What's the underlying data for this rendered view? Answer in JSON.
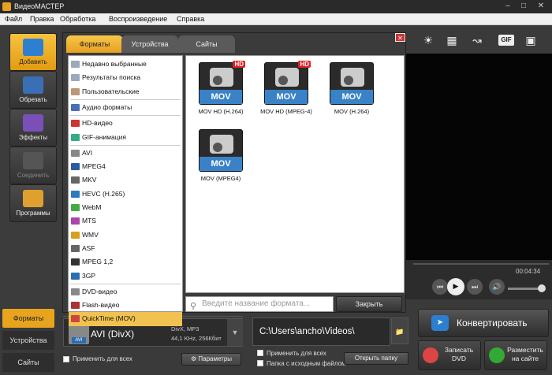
{
  "app": {
    "title": "ВидеоМАСТЕР"
  },
  "menu": [
    "Файл",
    "Правка",
    "Обработка",
    "Воспроизведение",
    "Справка"
  ],
  "sidebar": [
    {
      "label": "Добавить",
      "icon": "add-file-icon",
      "active": true
    },
    {
      "label": "Обрезать",
      "icon": "film-cut-icon"
    },
    {
      "label": "Эффекты",
      "icon": "effects-wand-icon"
    },
    {
      "label": "Соединить",
      "icon": "join-icon",
      "disabled": true
    },
    {
      "label": "Программы",
      "icon": "programs-icon"
    }
  ],
  "bottom_tabs": [
    "Форматы",
    "Устройства",
    "Сайты"
  ],
  "dialog": {
    "tabs": [
      "Форматы",
      "Устройства",
      "Сайты"
    ],
    "list": [
      {
        "label": "Недавно выбранные",
        "icon": "recent-icon"
      },
      {
        "label": "Результаты поиска",
        "icon": "search-icon"
      },
      {
        "label": "Пользовательские",
        "icon": "user-icon"
      },
      {
        "sep": true
      },
      {
        "label": "Аудио форматы",
        "icon": "music-note-icon"
      },
      {
        "sep": true
      },
      {
        "label": "HD-видео",
        "icon": "hd-icon"
      },
      {
        "label": "GIF-анимация",
        "icon": "gif-icon"
      },
      {
        "sep": true
      },
      {
        "label": "AVI",
        "icon": "avi-icon"
      },
      {
        "label": "MPEG4",
        "icon": "mp4-icon"
      },
      {
        "label": "MKV",
        "icon": "mkv-icon"
      },
      {
        "label": "HEVC (H.265)",
        "icon": "hevc-icon"
      },
      {
        "label": "WebM",
        "icon": "webm-icon"
      },
      {
        "label": "MTS",
        "icon": "mts-icon"
      },
      {
        "label": "WMV",
        "icon": "wmv-icon"
      },
      {
        "label": "ASF",
        "icon": "asf-icon"
      },
      {
        "label": "MPEG 1,2",
        "icon": "mpeg-icon"
      },
      {
        "label": "3GP",
        "icon": "3gp-icon"
      },
      {
        "sep": true
      },
      {
        "label": "DVD-видео",
        "icon": "dvd-icon"
      },
      {
        "label": "Flash-видео",
        "icon": "flash-icon"
      },
      {
        "label": "QuickTime (MOV)",
        "icon": "quicktime-icon",
        "selected": true
      }
    ],
    "formats": [
      {
        "label": "MOV HD (H.264)",
        "tag": "MOV",
        "hd": "HD"
      },
      {
        "label": "MOV HD (MPEG-4)",
        "tag": "MOV",
        "hd": "HD"
      },
      {
        "label": "MOV (H.264)",
        "tag": "MOV"
      },
      {
        "label": "MOV (MPEG4)",
        "tag": "MOV"
      }
    ],
    "search_placeholder": "Введите название формата...",
    "close_label": "Закрыть"
  },
  "preview": {
    "time": "00:04:34",
    "tools": [
      "brightness-icon",
      "film-strip-icon",
      "running-man-icon",
      "GIF",
      "fullscreen-icon"
    ]
  },
  "format_panel": {
    "name": "AVI (DivX)",
    "tag": "AVI",
    "line1": "DivX, MP3",
    "line2": "44,1 KHz, 256Кбит",
    "apply_all": "Применить для всех",
    "params": "Параметры"
  },
  "output": {
    "path": "C:\\Users\\ancho\\Videos\\",
    "apply_all": "Применить для всех",
    "source_folder": "Папка с исходным файлом",
    "open_folder": "Открыть папку"
  },
  "actions": {
    "convert": "Конвертировать",
    "burn": "Записать DVD",
    "publish": "Разместить на сайте"
  }
}
